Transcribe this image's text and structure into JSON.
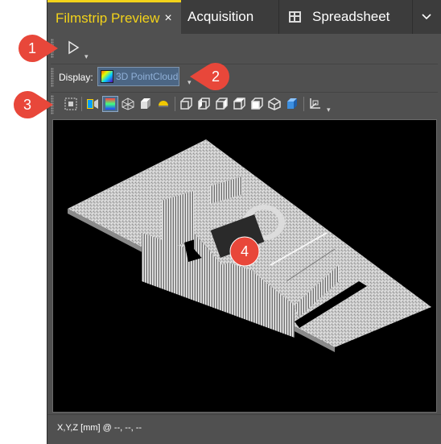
{
  "tabs": [
    {
      "label": "Filmstrip Preview",
      "active": true,
      "close": "×"
    },
    {
      "label": "Acquisition",
      "active": false
    },
    {
      "label": "Spreadsheet",
      "active": false,
      "icon": "spreadsheet-icon"
    }
  ],
  "tab_menu_glyph": "⌄",
  "toolbar1": {
    "play_icon": "play-icon",
    "overflow": "▾"
  },
  "display": {
    "label": "Display:",
    "value": "3D PointCloud",
    "icon": "pointcloud-icon",
    "overflow": "▾"
  },
  "toolbar3": {
    "tools": [
      "fit-view-icon",
      "camera-color-icon",
      "height-map-icon",
      "mesh-icon",
      "box-icon",
      "dome-icon",
      "view-front-icon",
      "view-left-icon",
      "view-right-icon",
      "view-back-icon",
      "view-top-icon",
      "view-iso-icon",
      "view-3d-cube-icon",
      "axes-icon"
    ],
    "overflow": "▾"
  },
  "status": {
    "coords": "X,Y,Z [mm] @ --, --, --"
  },
  "callouts": [
    "1",
    "2",
    "3",
    "4"
  ],
  "colors": {
    "accent": "#f2d21a",
    "callout": "#e8473a",
    "panel": "#505050",
    "tabbar": "#3c3c3c",
    "selection": "#4c6684"
  }
}
